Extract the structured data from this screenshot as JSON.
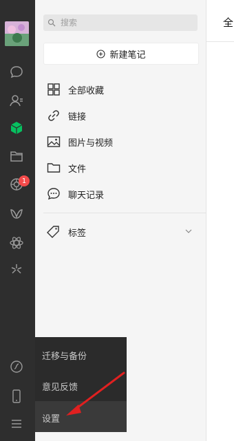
{
  "search": {
    "placeholder": "搜索"
  },
  "new_note": {
    "label": "新建笔记"
  },
  "menu": {
    "items": [
      {
        "label": "全部收藏",
        "icon": "grid-icon"
      },
      {
        "label": "链接",
        "icon": "link-icon"
      },
      {
        "label": "图片与视频",
        "icon": "image-icon"
      },
      {
        "label": "文件",
        "icon": "folder-icon"
      },
      {
        "label": "聊天记录",
        "icon": "chat-icon"
      }
    ],
    "tags_label": "标签"
  },
  "rail": {
    "badge_count": "1"
  },
  "right": {
    "title_partial": "全"
  },
  "popup": {
    "items": [
      {
        "label": "迁移与备份"
      },
      {
        "label": "意见反馈"
      },
      {
        "label": "设置"
      }
    ]
  },
  "colors": {
    "rail_bg": "#2e2e2e",
    "accent_green": "#07c160",
    "badge_red": "#f44b4b",
    "arrow_red": "#e02020"
  }
}
